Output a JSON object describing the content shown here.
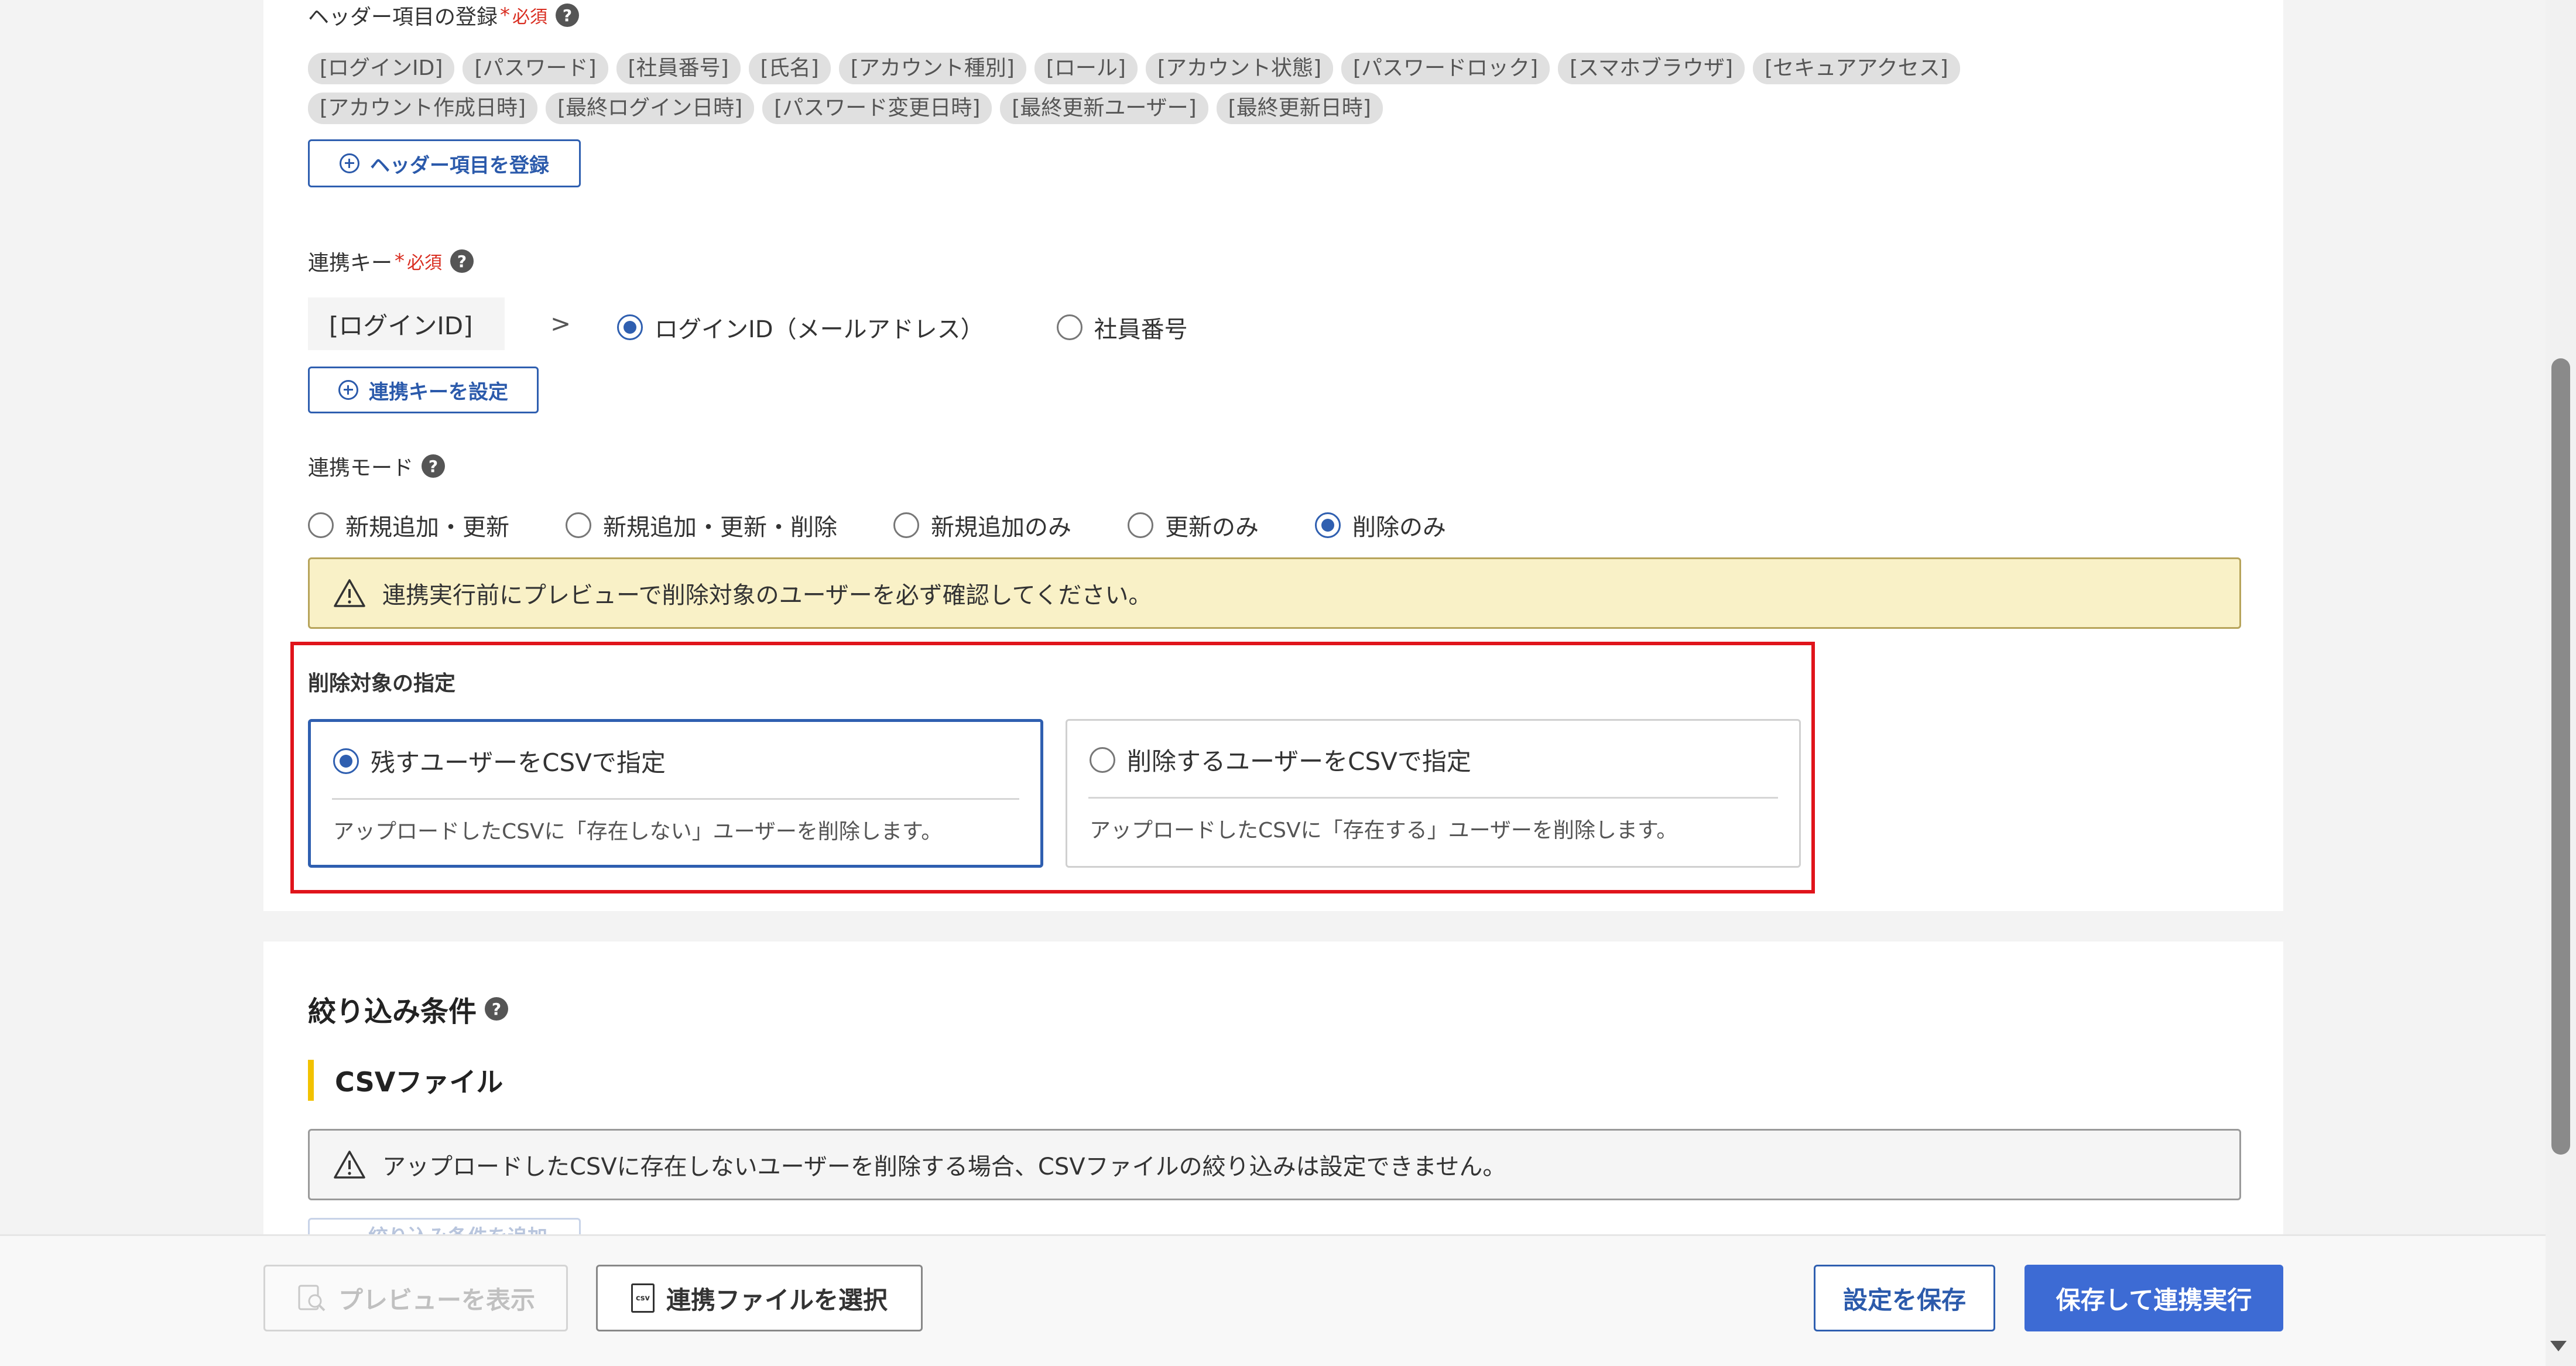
{
  "header_items": {
    "label": "ヘッダー項目の登録",
    "required_mark": "*",
    "required_text": "必須",
    "help_glyph": "?",
    "chips_row1": [
      "[ログインID]",
      "[パスワード]",
      "[社員番号]",
      "[氏名]",
      "[アカウント種別]",
      "[ロール]",
      "[アカウント状態]",
      "[パスワードロック]",
      "[スマホブラウザ]",
      "[セキュアアクセス]"
    ],
    "chips_row2": [
      "[アカウント作成日時]",
      "[最終ログイン日時]",
      "[パスワード変更日時]",
      "[最終更新ユーザー]",
      "[最終更新日時]"
    ],
    "register_button": "ヘッダー項目を登録"
  },
  "link_key": {
    "label": "連携キー",
    "required_mark": "*",
    "required_text": "必須",
    "help_glyph": "?",
    "source_field": "[ログインID]",
    "arrow": ">",
    "options": [
      {
        "label": "ログインID（メールアドレス）",
        "selected": true
      },
      {
        "label": "社員番号",
        "selected": false
      }
    ],
    "set_button": "連携キーを設定"
  },
  "link_mode": {
    "label": "連携モード",
    "help_glyph": "?",
    "options": [
      {
        "label": "新規追加・更新",
        "selected": false
      },
      {
        "label": "新規追加・更新・削除",
        "selected": false
      },
      {
        "label": "新規追加のみ",
        "selected": false
      },
      {
        "label": "更新のみ",
        "selected": false
      },
      {
        "label": "削除のみ",
        "selected": true
      }
    ],
    "warning": "連携実行前にプレビューで削除対象のユーザーを必ず確認してください。"
  },
  "delete_target": {
    "label": "削除対象の指定",
    "options": [
      {
        "title": "残すユーザーをCSVで指定",
        "description": "アップロードしたCSVに「存在しない」ユーザーを削除します。",
        "selected": true
      },
      {
        "title": "削除するユーザーをCSVで指定",
        "description": "アップロードしたCSVに「存在する」ユーザーを削除します。",
        "selected": false
      }
    ]
  },
  "filter": {
    "title": "絞り込み条件",
    "help_glyph": "?",
    "subsection": "CSVファイル",
    "info": "アップロードしたCSVに存在しないユーザーを削除する場合、CSVファイルの絞り込みは設定できません。",
    "add_button": "絞り込み条件を追加"
  },
  "footer": {
    "preview_button": "プレビューを表示",
    "select_file_button": "連携ファイルを選択",
    "csv_glyph": "csv",
    "save_button": "設定を保存",
    "save_and_run_button": "保存して連携実行"
  },
  "colors": {
    "accent": "#2f5fb0",
    "primary_button": "#3d6bd4",
    "required": "#d92d20",
    "highlight_border": "#e0141b",
    "warning_bg": "#f9f1c7",
    "section_bar": "#f2c200"
  }
}
